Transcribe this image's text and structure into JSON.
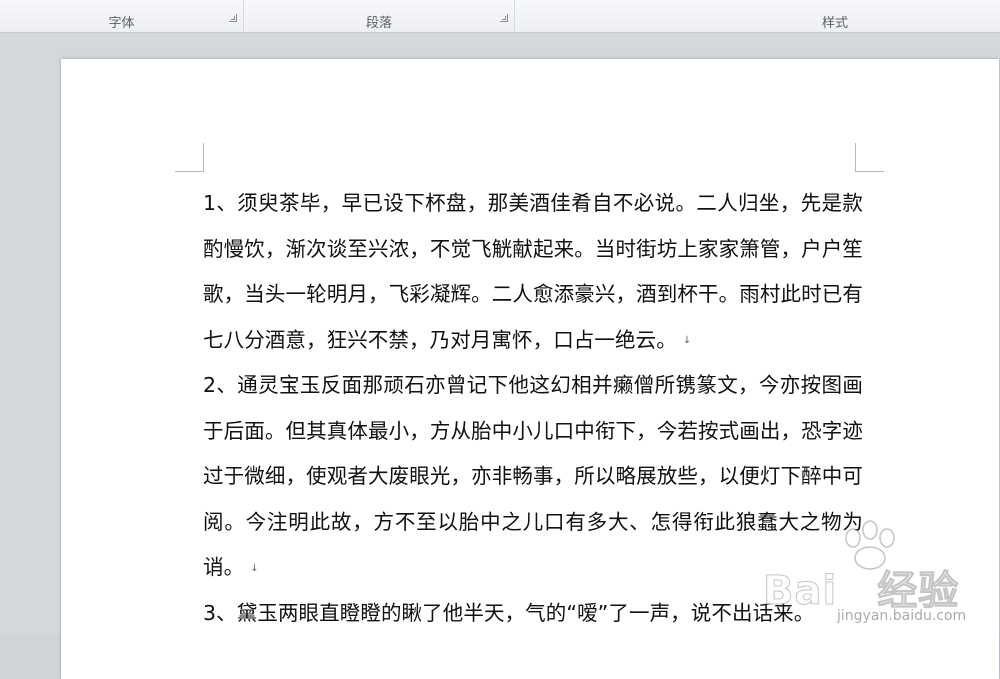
{
  "ribbon": {
    "groups": [
      {
        "label": "字体"
      },
      {
        "label": "段落"
      },
      {
        "label": "样式"
      }
    ]
  },
  "document": {
    "paragraphs": [
      "1、须臾茶毕，早已设下杯盘，那美酒佳肴自不必说。二人归坐，先是款酌慢饮，渐次谈至兴浓，不觉飞觥献起来。当时街坊上家家箫管，户户笙歌，当头一轮明月，飞彩凝辉。二人愈添豪兴，酒到杯干。雨村此时已有七八分酒意，狂兴不禁，乃对月寓怀，口占一绝云。",
      "2、通灵宝玉反面那顽石亦曾记下他这幻相并癞僧所镌篆文，今亦按图画于后面。但其真体最小，方从胎中小儿口中衔下，今若按式画出，恐字迹过于微细，使观者大废眼光，亦非畅事，所以略展放些，以便灯下醉中可阅。今注明此故，方不至以胎中之儿口有多大、怎得衔此狼蠢大之物为诮。",
      "3、黛玉两眼直瞪瞪的瞅了他半天，气的“嗳”了一声，说不出话来。"
    ],
    "paragraph_mark": "↓"
  },
  "watermark": {
    "brand": "Bai",
    "brand_tail": "经验",
    "url": "jingyan.baidu.com"
  }
}
